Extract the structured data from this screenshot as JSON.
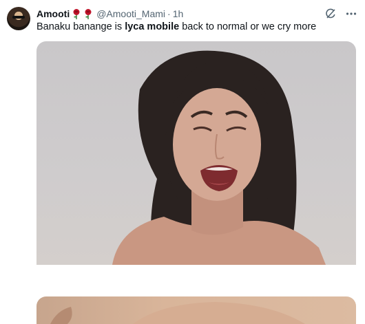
{
  "tweet": {
    "display_name": "Amooti",
    "handle": "@Amooti_Mami",
    "separator": "·",
    "time": "1h",
    "text_before": "Banaku banange is ",
    "text_bold": "lyca mobile",
    "text_after": " back to normal or we cry more"
  },
  "icons": {
    "badges": [
      "rose-icon",
      "rose-icon"
    ],
    "actions": [
      "grok-icon",
      "more-icon"
    ]
  },
  "media": [
    {
      "name": "crying-woman-image"
    },
    {
      "name": "second-image"
    }
  ]
}
